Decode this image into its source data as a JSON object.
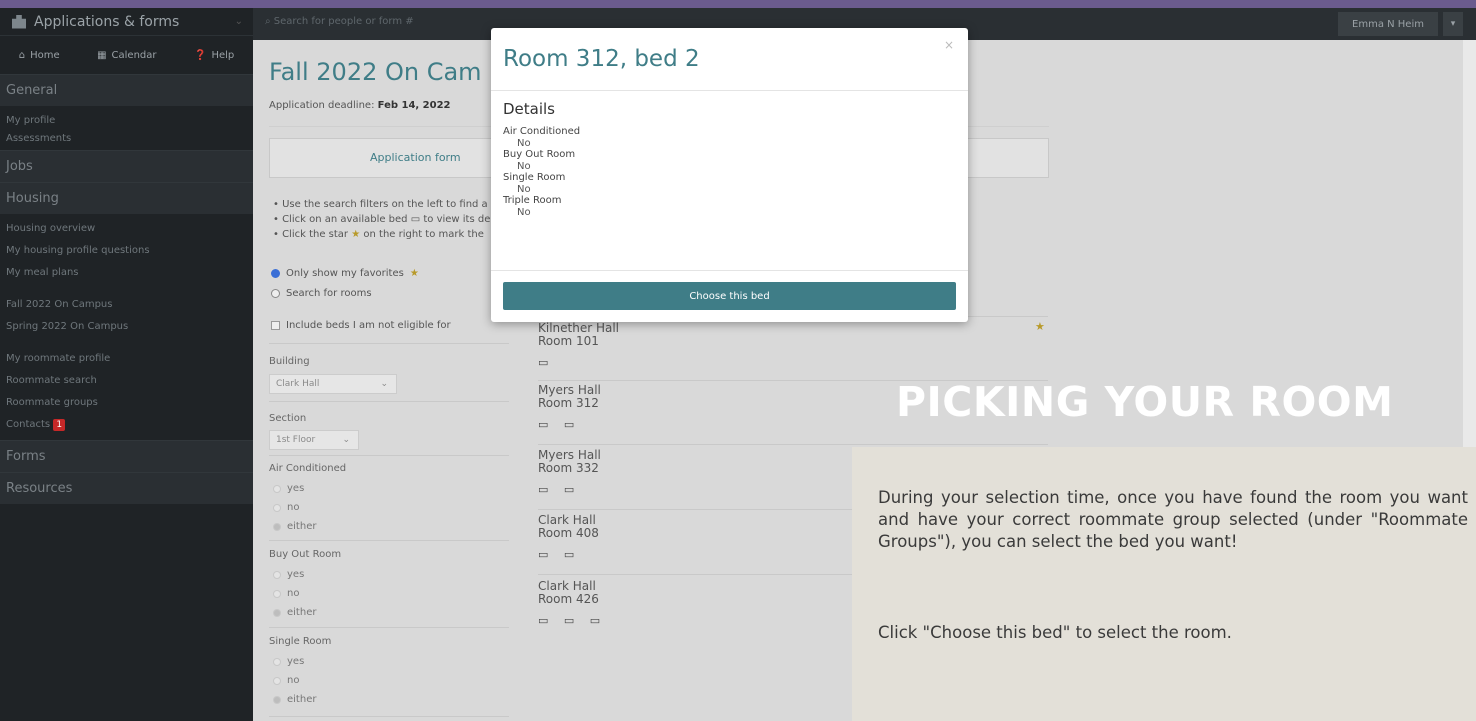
{
  "sidebar": {
    "app_title": "Applications & forms",
    "nav": {
      "home": "Home",
      "calendar": "Calendar",
      "help": "Help"
    },
    "sections": {
      "general": "General",
      "jobs": "Jobs",
      "housing": "Housing",
      "forms": "Forms",
      "resources": "Resources"
    },
    "general_links": [
      "My profile",
      "Assessments"
    ],
    "housing_links": {
      "overview": "Housing overview",
      "profile_questions": "My housing profile questions",
      "meal_plans": "My meal plans",
      "fall": "Fall 2022 On Campus",
      "spring": "Spring 2022 On Campus",
      "roommate_profile": "My roommate profile",
      "roommate_search": "Roommate search",
      "roommate_groups": "Roommate groups",
      "contacts": "Contacts",
      "contacts_badge": "1"
    }
  },
  "topbar": {
    "search_placeholder": "Search for people or form #",
    "user_name": "Emma N Heim"
  },
  "main": {
    "title": "Fall 2022 On Cam",
    "deadline_label": "Application deadline:",
    "deadline_value": "Feb 14, 2022",
    "tab_application_form": "Application form",
    "bullets": [
      "Use the search filters on the left to find a",
      "Click on an available bed",
      "to view its de",
      "Click the star",
      "on the right to mark the"
    ],
    "radio_favorites": "Only show my favorites",
    "radio_search": "Search for rooms",
    "checkbox_ineligible": "Include beds I am not eligible for",
    "filters": {
      "building_label": "Building",
      "building_value": "Clark Hall",
      "section_label": "Section",
      "section_value": "1st Floor",
      "ac_label": "Air Conditioned",
      "buyout_label": "Buy Out Room",
      "single_label": "Single Room",
      "options": [
        "yes",
        "no",
        "either"
      ]
    },
    "rooms": [
      {
        "hall": "Kilnether Hall",
        "room": "Room 101",
        "beds": "▭"
      },
      {
        "hall": "Myers Hall",
        "room": "Room 312",
        "beds": "▭ ▭"
      },
      {
        "hall": "Myers Hall",
        "room": "Room 332",
        "beds": "▭ ▭"
      },
      {
        "hall": "Clark Hall",
        "room": "Room 408",
        "beds": "▭ ▭"
      },
      {
        "hall": "Clark Hall",
        "room": "Room 426",
        "beds": "▭ ▭ ▭"
      }
    ]
  },
  "modal": {
    "title": "Room 312, bed 2",
    "close": "×",
    "details_heading": "Details",
    "details": [
      {
        "label": "Air Conditioned",
        "value": "No"
      },
      {
        "label": "Buy Out Room",
        "value": "No"
      },
      {
        "label": "Single Room",
        "value": "No"
      },
      {
        "label": "Triple Room",
        "value": "No"
      }
    ],
    "choose_button": "Choose this bed"
  },
  "overlay": {
    "headline": "PICKING YOUR ROOM",
    "paragraph1": "During your selection time, once you have found the room you want and have your correct roommate group selected (under \"Roommate Groups\"), you can select the bed you want!",
    "paragraph2": "Click \"Choose this bed\" to select the room."
  },
  "colors": {
    "accent_teal": "#3f7d87",
    "sidebar_bg": "#1f2326",
    "top_strip": "#6b5b8e",
    "card_bg": "#e3e0d8"
  }
}
